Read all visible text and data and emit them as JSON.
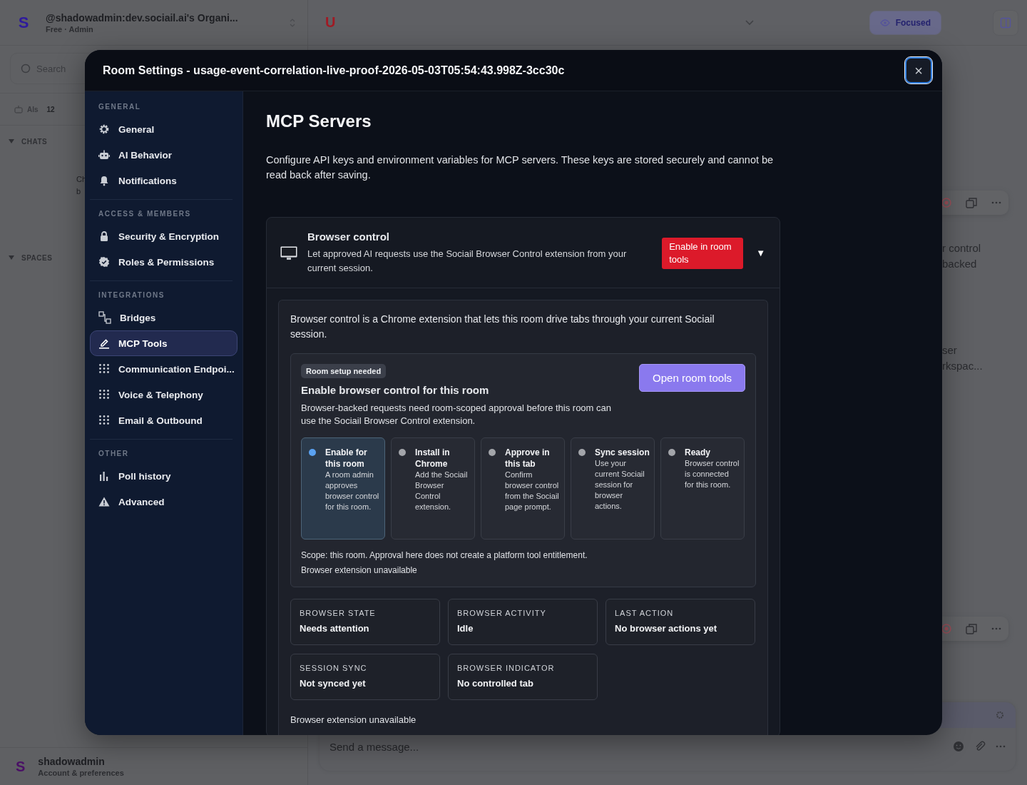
{
  "app": {
    "workspace": {
      "avatar": "S",
      "name": "@shadowadmin:dev.sociail.ai's Organi...",
      "plan": "Free · Admin"
    },
    "search": {
      "placeholder": "Search"
    },
    "ais": {
      "label": "AIs",
      "count": "12"
    },
    "sections": [
      {
        "label": "CHATS",
        "expanded": true,
        "fragments": [
          "Ch",
          "b"
        ]
      },
      {
        "label": "SPACES",
        "expanded": true
      }
    ],
    "user": {
      "avatar": "S",
      "name": "shadowadmin",
      "subtitle": "Account & preferences"
    },
    "room_avatar": "U",
    "focus_button": "Focused",
    "messages": [
      {
        "fragment_lines": [
          "r control",
          "backed"
        ]
      },
      {
        "fragment_lines": [
          "ser",
          "rkspac..."
        ]
      }
    ],
    "composer": {
      "placeholder": "Send a message..."
    }
  },
  "modal": {
    "title": "Room Settings - usage-event-correlation-live-proof-2026-05-03T05:54:43.998Z-3cc30c",
    "close": "×",
    "nav": [
      {
        "heading": "GENERAL",
        "items": [
          {
            "label": "General",
            "kind": "gear",
            "selected": false
          },
          {
            "label": "AI Behavior",
            "kind": "robot",
            "selected": false
          },
          {
            "label": "Notifications",
            "kind": "bell",
            "selected": false
          }
        ]
      },
      {
        "heading": "ACCESS & MEMBERS",
        "items": [
          {
            "label": "Security & Encryption",
            "kind": "lock",
            "selected": false
          },
          {
            "label": "Roles & Permissions",
            "kind": "badge",
            "selected": false
          }
        ]
      },
      {
        "heading": "INTEGRATIONS",
        "items": [
          {
            "label": "Bridges",
            "kind": "bridges",
            "selected": false
          },
          {
            "label": "MCP Tools",
            "kind": "pen",
            "selected": true
          },
          {
            "label": "Communication Endpoi...",
            "kind": "dots",
            "selected": false
          },
          {
            "label": "Voice & Telephony",
            "kind": "dots",
            "selected": false
          },
          {
            "label": "Email & Outbound",
            "kind": "dots",
            "selected": false
          }
        ]
      },
      {
        "heading": "OTHER",
        "items": [
          {
            "label": "Poll history",
            "kind": "chart",
            "selected": false
          },
          {
            "label": "Advanced",
            "kind": "warning",
            "selected": false
          }
        ]
      }
    ],
    "page": {
      "title": "MCP Servers",
      "description": "Configure API keys and environment variables for MCP servers. These keys are stored securely and cannot be read back after saving.",
      "server": {
        "name": "Browser control",
        "description": "Let approved AI requests use the Sociail Browser Control extension from your current session.",
        "action": "Enable in room tools",
        "toggle": "▼",
        "expanded": true,
        "intro": "Browser control is a Chrome extension that lets this room drive tabs through your current Sociail session.",
        "setup": {
          "badge": "Room setup needed",
          "title": "Enable browser control for this room",
          "description": "Browser-backed requests need room-scoped approval before this room can use the Sociail Browser Control extension.",
          "button": "Open room tools",
          "steps": [
            {
              "title": "Enable for this room",
              "description": "A room admin approves browser control for this room.",
              "selected": true
            },
            {
              "title": "Install in Chrome",
              "description": "Add the Sociail Browser Control extension.",
              "selected": false
            },
            {
              "title": "Approve in this tab",
              "description": "Confirm browser control from the Sociail page prompt.",
              "selected": false
            },
            {
              "title": "Sync session",
              "description": "Use your current Sociail session for browser actions.",
              "selected": false
            },
            {
              "title": "Ready",
              "description": "Browser control is connected for this room.",
              "selected": false
            }
          ],
          "scope": "Scope: this room. Approval here does not create a platform tool entitlement.",
          "status": "Browser extension unavailable"
        },
        "stats": [
          {
            "label": "BROWSER STATE",
            "value": "Needs attention"
          },
          {
            "label": "BROWSER ACTIVITY",
            "value": "Idle"
          },
          {
            "label": "LAST ACTION",
            "value": "No browser actions yet"
          },
          {
            "label": "SESSION SYNC",
            "value": "Not synced yet"
          },
          {
            "label": "BROWSER INDICATOR",
            "value": "No controlled tab"
          }
        ],
        "footer": "Browser extension unavailable"
      }
    }
  }
}
